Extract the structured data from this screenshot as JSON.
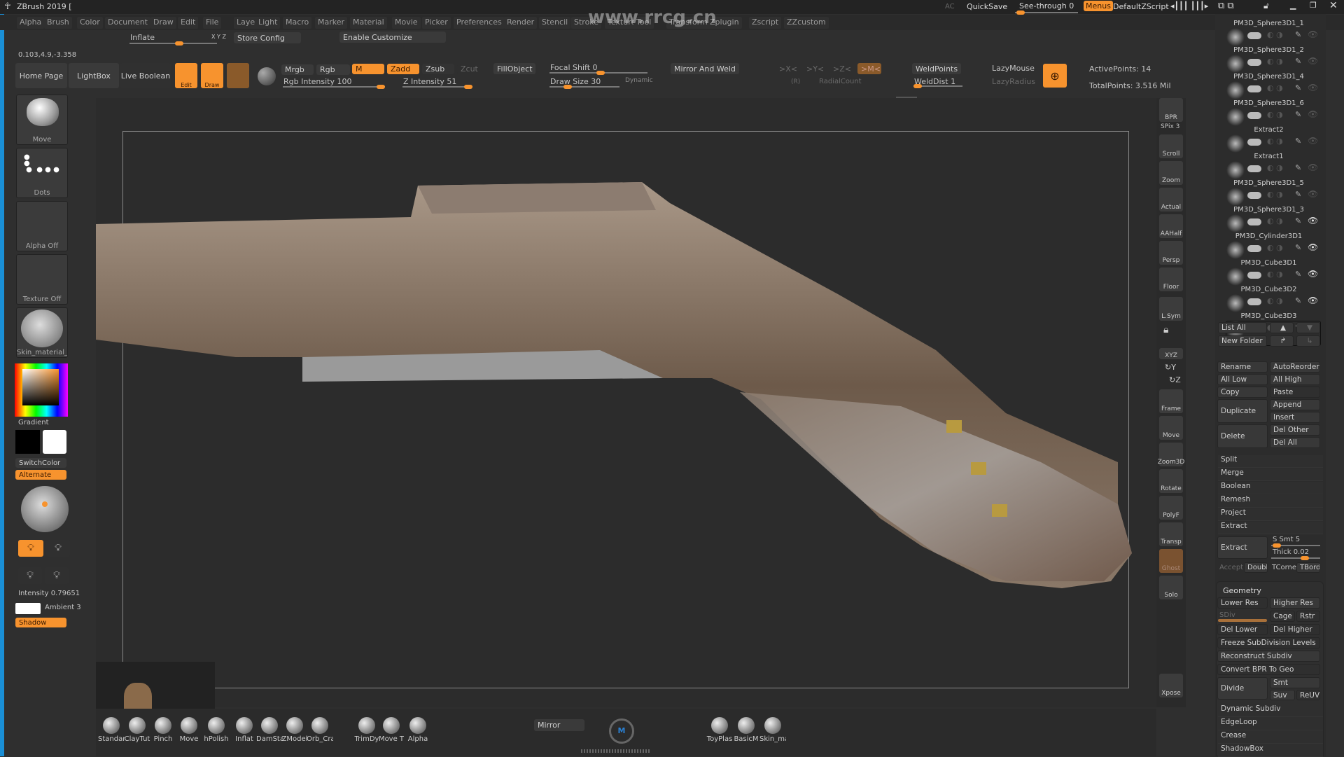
{
  "app": {
    "title": "ZBrush 2019 [",
    "coords": "0.103,4.9,-3.358",
    "accent": "#f7932e"
  },
  "titlebar": {
    "ac": "AC",
    "quicksave": "QuickSave",
    "see_through": "See-through  0",
    "see_through_value": 0,
    "menus": "Menus",
    "default_zscript": "DefaultZScript"
  },
  "menu": [
    "Alpha",
    "Brush",
    "Color",
    "Document",
    "Draw",
    "Edit",
    "File",
    "Layer",
    "Light",
    "Macro",
    "Marker",
    "Material",
    "Movie",
    "Picker",
    "Preferences",
    "Render",
    "Stencil",
    "Stroke",
    "Texture",
    "Tool",
    "Transform",
    "Zplugin",
    "Zscript",
    "ZZcustom"
  ],
  "watermark": "www.rrcg.cn",
  "customize": {
    "inflate": "Inflate",
    "xyz": "X Y Z",
    "store_config": "Store Config",
    "enable_customize": "Enable Customize"
  },
  "toolbar": {
    "home": "Home Page",
    "lightbox": "LightBox",
    "live_boolean": "Live Boolean",
    "edit": "Edit",
    "draw": "Draw",
    "mrgb": "Mrgb",
    "rgb": "Rgb",
    "m": "M",
    "zadd": "Zadd",
    "zsub": "Zsub",
    "zcut": "Zcut",
    "rgb_intensity": "Rgb Intensity 100",
    "z_intensity": "Z Intensity 51",
    "fill_object": "FillObject",
    "focal_shift": "Focal Shift 0",
    "draw_size": "Draw Size 30",
    "dynamic": "Dynamic",
    "mirror_weld": "Mirror And Weld",
    "x": ">X<",
    "y": ">Y<",
    "z": ">Z<",
    "mm": ">M<",
    "r": "(R)",
    "radial_count": "RadialCount",
    "weld_points": "WeldPoints",
    "weld_dist": "WeldDist 1",
    "lazy_mouse": "LazyMouse",
    "lazy_radius": "LazyRadius",
    "active_points": "ActivePoints: 14",
    "total_points": "TotalPoints: 3.516 Mil"
  },
  "left": {
    "brush": "Move",
    "stroke": "Dots",
    "alpha": "Alpha Off",
    "texture": "Texture Off",
    "material": "Skin_material_A",
    "gradient": "Gradient",
    "switch_color": "SwitchColor",
    "alternate": "Alternate",
    "intensity": "Intensity 0.79651",
    "ambient": "Ambient 3",
    "shadow": "Shadow"
  },
  "right_tools": [
    "BPR",
    "SPix 3",
    "Scroll",
    "Zoom",
    "Actual",
    "AAHalf",
    "Persp",
    "Floor",
    "L.Sym",
    "",
    "XYZ",
    "",
    "",
    "Frame",
    "Move",
    "Zoom3D",
    "Rotate",
    "PolyF",
    "Transp",
    "Ghost",
    "Solo",
    "Xpose"
  ],
  "subtools": [
    {
      "name": "PM3D_Sphere3D1_1",
      "visible": false
    },
    {
      "name": "PM3D_Sphere3D1_2",
      "visible": false
    },
    {
      "name": "PM3D_Sphere3D1_4",
      "visible": false
    },
    {
      "name": "PM3D_Sphere3D1_6",
      "visible": false
    },
    {
      "name": "Extract2",
      "visible": false
    },
    {
      "name": "Extract1",
      "visible": false
    },
    {
      "name": "PM3D_Sphere3D1_5",
      "visible": false
    },
    {
      "name": "PM3D_Sphere3D1_3",
      "visible": true
    },
    {
      "name": "PM3D_Cylinder3D1",
      "visible": true
    },
    {
      "name": "PM3D_Cube3D1",
      "visible": true
    },
    {
      "name": "PM3D_Cube3D2",
      "visible": true
    },
    {
      "name": "PM3D_Cube3D3",
      "visible": true,
      "selected": true
    }
  ],
  "subtool_ops": {
    "list_all": "List All",
    "new_folder": "New Folder",
    "rename": "Rename",
    "autoreorder": "AutoReorder",
    "all_low": "All Low",
    "all_high": "All High",
    "copy": "Copy",
    "paste": "Paste",
    "duplicate": "Duplicate",
    "append": "Append",
    "insert": "Insert",
    "delete": "Delete",
    "del_other": "Del Other",
    "del_all": "Del All",
    "split": "Split",
    "merge": "Merge",
    "boolean": "Boolean",
    "remesh": "Remesh",
    "project": "Project",
    "extract_section": "Extract",
    "extract": "Extract",
    "s_smt": "S Smt 5",
    "thick": "Thick 0.02",
    "accept": "Accept",
    "double": "Double",
    "tcorner": "TCorne",
    "tborder": "TBorde"
  },
  "geometry": {
    "title": "Geometry",
    "lower_res": "Lower Res",
    "higher_res": "Higher Res",
    "sdiv": "SDiv",
    "cage": "Cage",
    "rstr": "Rstr",
    "del_lower": "Del Lower",
    "del_higher": "Del Higher",
    "freeze": "Freeze SubDivision Levels",
    "reconstruct": "Reconstruct Subdiv",
    "convert_bpr": "Convert BPR To Geo",
    "divide": "Divide",
    "smt": "Smt",
    "suv": "Suv",
    "reuv": "ReUV",
    "dynamic_subdiv": "Dynamic Subdiv",
    "edgeloop": "EdgeLoop",
    "crease": "Crease",
    "shadowbox": "ShadowBox"
  },
  "bottom": {
    "brushes": [
      "Standar",
      "ClayTut",
      "Pinch",
      "Move",
      "hPolish",
      "Inflat",
      "DamSta",
      "ZModel",
      "Orb_Cra",
      "TrimDy",
      "Move T",
      "Alpha"
    ],
    "mirror": "Mirror",
    "materials": [
      "ToyPlas",
      "BasicM",
      "Skin_ma"
    ]
  }
}
